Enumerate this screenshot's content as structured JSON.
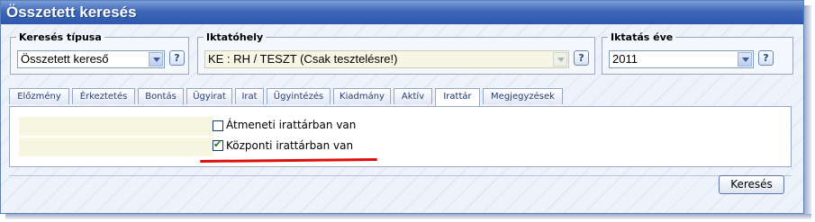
{
  "window": {
    "title": "Összetett keresés"
  },
  "search_type": {
    "legend": "Keresés típusa",
    "value": "Összetett kereső",
    "help": "?"
  },
  "registry": {
    "legend": "Iktatóhely",
    "value": "KE : RH / TESZT (Csak tesztelésre!)",
    "help": "?"
  },
  "year": {
    "legend": "Iktatás éve",
    "value": "2011",
    "help": "?"
  },
  "tabs": [
    {
      "label": "Előzmény"
    },
    {
      "label": "Érkeztetés"
    },
    {
      "label": "Bontás"
    },
    {
      "label": "Ügyirat"
    },
    {
      "label": "Irat"
    },
    {
      "label": "Ügyintézés"
    },
    {
      "label": "Kiadmány"
    },
    {
      "label": "Aktív"
    },
    {
      "label": "Irattár"
    },
    {
      "label": "Megjegyzések"
    }
  ],
  "active_tab": "Irattár",
  "archive": {
    "temporary": {
      "label": "Átmeneti irattárban van",
      "checked": false
    },
    "central": {
      "label": "Központi irattárban van",
      "checked": true
    }
  },
  "actions": {
    "search_label": "Keresés"
  }
}
